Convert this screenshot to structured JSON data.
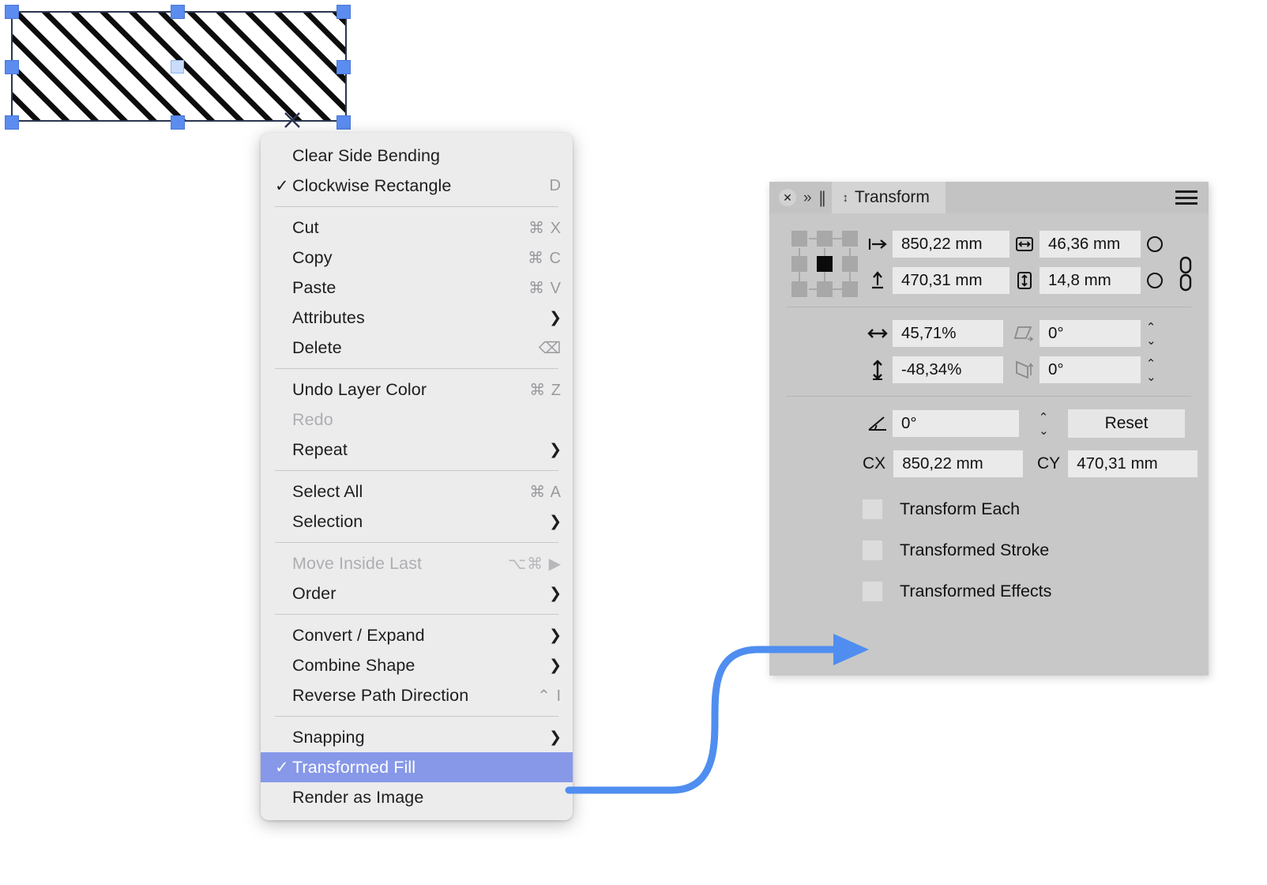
{
  "canvas": {
    "shape": {
      "name": "hatched-rectangle",
      "fill_pattern": "diagonal-hatch",
      "stroke_color": "#2b3550",
      "handle_color": "#5b8cf0"
    },
    "cursor_mark": "×"
  },
  "context_menu": {
    "groups": [
      {
        "items": [
          {
            "label": "Clear Side Bending",
            "checked": false,
            "shortcut": "",
            "submenu": false,
            "disabled": false,
            "selected": false
          },
          {
            "label": "Clockwise Rectangle",
            "checked": true,
            "shortcut": "D",
            "submenu": false,
            "disabled": false,
            "selected": false
          }
        ]
      },
      {
        "items": [
          {
            "label": "Cut",
            "checked": false,
            "shortcut": "⌘ X",
            "submenu": false,
            "disabled": false,
            "selected": false
          },
          {
            "label": "Copy",
            "checked": false,
            "shortcut": "⌘ C",
            "submenu": false,
            "disabled": false,
            "selected": false
          },
          {
            "label": "Paste",
            "checked": false,
            "shortcut": "⌘ V",
            "submenu": false,
            "disabled": false,
            "selected": false
          },
          {
            "label": "Attributes",
            "checked": false,
            "shortcut": "",
            "submenu": true,
            "disabled": false,
            "selected": false
          },
          {
            "label": "Delete",
            "checked": false,
            "shortcut": "⌫",
            "submenu": false,
            "disabled": false,
            "selected": false
          }
        ]
      },
      {
        "items": [
          {
            "label": "Undo Layer Color",
            "checked": false,
            "shortcut": "⌘ Z",
            "submenu": false,
            "disabled": false,
            "selected": false
          },
          {
            "label": "Redo",
            "checked": false,
            "shortcut": "",
            "submenu": false,
            "disabled": true,
            "selected": false
          },
          {
            "label": "Repeat",
            "checked": false,
            "shortcut": "",
            "submenu": true,
            "disabled": false,
            "selected": false
          }
        ]
      },
      {
        "items": [
          {
            "label": "Select All",
            "checked": false,
            "shortcut": "⌘ A",
            "submenu": false,
            "disabled": false,
            "selected": false
          },
          {
            "label": "Selection",
            "checked": false,
            "shortcut": "",
            "submenu": true,
            "disabled": false,
            "selected": false
          }
        ]
      },
      {
        "items": [
          {
            "label": "Move Inside Last",
            "checked": false,
            "shortcut": "⌥⌘ ▶",
            "submenu": false,
            "disabled": true,
            "selected": false
          },
          {
            "label": "Order",
            "checked": false,
            "shortcut": "",
            "submenu": true,
            "disabled": false,
            "selected": false
          }
        ]
      },
      {
        "items": [
          {
            "label": "Convert / Expand",
            "checked": false,
            "shortcut": "",
            "submenu": true,
            "disabled": false,
            "selected": false
          },
          {
            "label": "Combine Shape",
            "checked": false,
            "shortcut": "",
            "submenu": true,
            "disabled": false,
            "selected": false
          },
          {
            "label": "Reverse Path Direction",
            "checked": false,
            "shortcut": "⌃ I",
            "submenu": false,
            "disabled": false,
            "selected": false
          }
        ]
      },
      {
        "items": [
          {
            "label": "Snapping",
            "checked": false,
            "shortcut": "",
            "submenu": true,
            "disabled": false,
            "selected": false
          },
          {
            "label": "Transformed Fill",
            "checked": true,
            "shortcut": "",
            "submenu": false,
            "disabled": false,
            "selected": true
          },
          {
            "label": "Render as Image",
            "checked": false,
            "shortcut": "",
            "submenu": false,
            "disabled": false,
            "selected": false
          }
        ]
      }
    ],
    "highlight_color": "#8798e8"
  },
  "transform_panel": {
    "title": "Transform",
    "titlebar": {
      "close_icon": "close-icon",
      "collapse_icon": "double-chevron-right-icon",
      "grip_icon": "grip-bars-icon",
      "tab_updown_icon": "updown-chevron-icon",
      "menu_icon": "hamburger-menu-icon"
    },
    "anchor_point": "center",
    "fields": {
      "x_label_icon": "left-align-arrow-icon",
      "x_value": "850,22 mm",
      "width_icon": "width-arrow-icon",
      "width_value": "46,36 mm",
      "y_label_icon": "up-align-arrow-icon",
      "y_value": "470,31 mm",
      "height_icon": "height-arrow-icon",
      "height_value": "14,8 mm",
      "scale_x_icon": "horizontal-arrow-icon",
      "scale_x_value": "45,71%",
      "skew_x_icon": "skew-horizontal-icon",
      "skew_x_value": "0°",
      "scale_y_icon": "vertical-arrow-icon",
      "scale_y_value": "-48,34%",
      "skew_y_icon": "skew-vertical-icon",
      "skew_y_value": "0°",
      "rotation_icon": "angle-icon",
      "rotation_value": "0°",
      "reset_label": "Reset",
      "cx_label": "CX",
      "cx_value": "850,22 mm",
      "cy_label": "CY",
      "cy_value": "470,31 mm"
    },
    "checkboxes": [
      {
        "label": "Transform Each",
        "checked": false
      },
      {
        "label": "Transformed Stroke",
        "checked": false
      },
      {
        "label": "Transformed Effects",
        "checked": false
      }
    ],
    "link_icon": "chain-link-icon",
    "panel_bg": "#c8c8c8"
  },
  "annotation": {
    "arrow_color": "#4f8ef0",
    "name": "pointer-arrow"
  }
}
